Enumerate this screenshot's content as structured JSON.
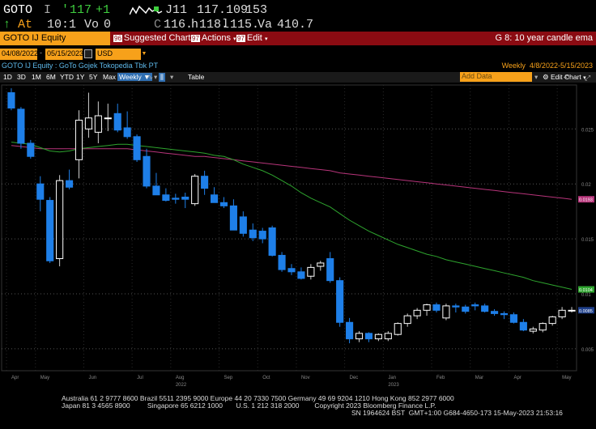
{
  "quote": {
    "ticker": "GOTO",
    "indicator": "I",
    "last_prefix": "'",
    "last": "117",
    "change": "+1",
    "at_label": "At",
    "time": "10:1",
    "vol_label": "Vo",
    "volume": "0",
    "open_prefix": "J11",
    "open": "117.109",
    "open_suffix": "153",
    "bid_prefix": "C",
    "bid": "116.",
    "bid_flag": "h",
    "ask": "118.",
    "ask_flag": "l",
    "high": "115.",
    "val_label": "Va",
    "value": "410.7"
  },
  "function_bar": {
    "security": "GOTO IJ Equity",
    "menus": [
      {
        "num": "96",
        "label": "Suggested Charts"
      },
      {
        "num": "97",
        "label": "Actions"
      },
      {
        "num": "97",
        "label": "Edit"
      }
    ],
    "function_label": "G 8: 10 year candle ema"
  },
  "controls": {
    "start_date": "04/08/2022",
    "end_date": "05/15/2023",
    "currency": "USD",
    "title": "GOTO IJ Equity : GoTo Gojek Tokopedia Tbk PT",
    "period": "Weekly",
    "range": "4/8/2022-5/15/2023",
    "periods": [
      "1D",
      "3D",
      "1M",
      "6M",
      "YTD",
      "1Y",
      "5Y",
      "Max"
    ],
    "frequency": "Weekly",
    "table_label": "Table",
    "add_data_placeholder": "Add Data",
    "edit_chart": "Edit Chart"
  },
  "chart_data": {
    "type": "candlestick",
    "ylim": [
      0.003,
      0.029
    ],
    "y_ticks": [
      0.005,
      0.01,
      0.015,
      0.02,
      0.025
    ],
    "y_tick_labels": [
      "0.005",
      "0.01",
      "0.015",
      "0.02",
      "0.025"
    ],
    "x_tick_labels": [
      "Apr",
      "May",
      "Jun",
      "Jul",
      "Aug",
      "Sep",
      "Oct",
      "Nov",
      "Dec",
      "Jan",
      "Feb",
      "Mar",
      "Apr",
      "May"
    ],
    "year_labels": [
      "2022",
      "2023"
    ],
    "candles": [
      [
        0.0283,
        0.0287,
        0.0267,
        0.0269
      ],
      [
        0.0268,
        0.027,
        0.0232,
        0.0237
      ],
      [
        0.0237,
        0.024,
        0.0223,
        0.0225
      ],
      [
        0.02,
        0.0207,
        0.0175,
        0.0186
      ],
      [
        0.0185,
        0.0188,
        0.0128,
        0.013
      ],
      [
        0.0132,
        0.0208,
        0.0125,
        0.0203
      ],
      [
        0.0203,
        0.0213,
        0.0195,
        0.0197
      ],
      [
        0.0222,
        0.0267,
        0.0205,
        0.0258
      ],
      [
        0.025,
        0.0283,
        0.0242,
        0.026
      ],
      [
        0.0247,
        0.0275,
        0.0237,
        0.0262
      ],
      [
        0.026,
        0.0273,
        0.0248,
        0.026
      ],
      [
        0.0264,
        0.0273,
        0.0247,
        0.0249
      ],
      [
        0.0251,
        0.0266,
        0.0241,
        0.0243
      ],
      [
        0.0243,
        0.0245,
        0.022,
        0.0222
      ],
      [
        0.0225,
        0.0232,
        0.0196,
        0.0198
      ],
      [
        0.0198,
        0.021,
        0.0193,
        0.019
      ],
      [
        0.019,
        0.0196,
        0.0184,
        0.0185
      ],
      [
        0.0187,
        0.0191,
        0.0182,
        0.0186
      ],
      [
        0.0188,
        0.0192,
        0.0178,
        0.0186
      ],
      [
        0.0182,
        0.0209,
        0.018,
        0.0207
      ],
      [
        0.0207,
        0.0212,
        0.019,
        0.0196
      ],
      [
        0.019,
        0.0197,
        0.0183,
        0.0183
      ],
      [
        0.0183,
        0.0188,
        0.0178,
        0.018
      ],
      [
        0.018,
        0.0186,
        0.0163,
        0.0158
      ],
      [
        0.017,
        0.0175,
        0.0152,
        0.0155
      ],
      [
        0.0158,
        0.0164,
        0.0148,
        0.0151
      ],
      [
        0.0157,
        0.016,
        0.0146,
        0.015
      ],
      [
        0.016,
        0.0162,
        0.0134,
        0.0135
      ],
      [
        0.0135,
        0.0138,
        0.012,
        0.0122
      ],
      [
        0.0123,
        0.0127,
        0.0117,
        0.012
      ],
      [
        0.012,
        0.0124,
        0.0113,
        0.0114
      ],
      [
        0.0116,
        0.0127,
        0.0113,
        0.0124
      ],
      [
        0.0125,
        0.013,
        0.0121,
        0.0128
      ],
      [
        0.0132,
        0.0138,
        0.011,
        0.0112
      ],
      [
        0.0112,
        0.0115,
        0.007,
        0.0074
      ],
      [
        0.0074,
        0.0078,
        0.0055,
        0.0059
      ],
      [
        0.0059,
        0.0066,
        0.0056,
        0.0064
      ],
      [
        0.0064,
        0.0065,
        0.0056,
        0.0059
      ],
      [
        0.0059,
        0.0064,
        0.0057,
        0.0063
      ],
      [
        0.0059,
        0.0066,
        0.0057,
        0.0064
      ],
      [
        0.0063,
        0.0074,
        0.0062,
        0.0073
      ],
      [
        0.0073,
        0.0082,
        0.007,
        0.008
      ],
      [
        0.008,
        0.0087,
        0.0077,
        0.0085
      ],
      [
        0.0085,
        0.0091,
        0.008,
        0.009
      ],
      [
        0.009,
        0.0092,
        0.0083,
        0.0085
      ],
      [
        0.0078,
        0.0091,
        0.0076,
        0.0089
      ],
      [
        0.0089,
        0.0091,
        0.0083,
        0.0088
      ],
      [
        0.0088,
        0.009,
        0.0082,
        0.0084
      ],
      [
        0.009,
        0.0092,
        0.0085,
        0.0089
      ],
      [
        0.0089,
        0.0091,
        0.0083,
        0.0084
      ],
      [
        0.0084,
        0.0086,
        0.008,
        0.0082
      ],
      [
        0.0082,
        0.0084,
        0.0077,
        0.0081
      ],
      [
        0.0081,
        0.0083,
        0.0073,
        0.0074
      ],
      [
        0.0074,
        0.0077,
        0.0066,
        0.0067
      ],
      [
        0.0066,
        0.007,
        0.0064,
        0.0068
      ],
      [
        0.0067,
        0.0074,
        0.0065,
        0.0073
      ],
      [
        0.0073,
        0.008,
        0.0071,
        0.0079
      ],
      [
        0.0079,
        0.0088,
        0.0077,
        0.0085
      ],
      [
        0.0085,
        0.0088,
        0.0083,
        0.0085
      ]
    ],
    "ema_long": {
      "color": "#b7347a",
      "values": [
        0.0235,
        0.0234,
        0.0233,
        0.0232,
        0.0232,
        0.0232,
        0.0232,
        0.0232,
        0.0232,
        0.0232,
        0.0232,
        0.0232,
        0.0232,
        0.0231,
        0.023,
        0.0229,
        0.0228,
        0.0227,
        0.0226,
        0.0225,
        0.0225,
        0.0224,
        0.0223,
        0.0222,
        0.0221,
        0.022,
        0.0219,
        0.0218,
        0.0217,
        0.0216,
        0.0215,
        0.0214,
        0.0213,
        0.0212,
        0.021,
        0.0209,
        0.0208,
        0.0207,
        0.0206,
        0.0205,
        0.0204,
        0.0203,
        0.0202,
        0.0201,
        0.02,
        0.0199,
        0.0198,
        0.0197,
        0.0196,
        0.0195,
        0.0194,
        0.0193,
        0.0192,
        0.0191,
        0.019,
        0.0189,
        0.0188,
        0.0187,
        0.0186
      ],
      "end_label": "0.0193"
    },
    "ema_short": {
      "color": "#2ea42e",
      "values": [
        0.0238,
        0.0237,
        0.0236,
        0.0233,
        0.023,
        0.0229,
        0.023,
        0.0232,
        0.0233,
        0.0234,
        0.0235,
        0.0236,
        0.0236,
        0.0235,
        0.0234,
        0.0233,
        0.0232,
        0.0231,
        0.023,
        0.0229,
        0.0228,
        0.0226,
        0.0225,
        0.0222,
        0.0218,
        0.0215,
        0.0212,
        0.0208,
        0.0203,
        0.0198,
        0.0192,
        0.0187,
        0.0183,
        0.0179,
        0.0173,
        0.0167,
        0.0162,
        0.0157,
        0.0153,
        0.0149,
        0.0145,
        0.0142,
        0.0139,
        0.0136,
        0.0134,
        0.0131,
        0.0129,
        0.0127,
        0.0125,
        0.0123,
        0.0121,
        0.0119,
        0.0117,
        0.0115,
        0.0112,
        0.011,
        0.0108,
        0.0106,
        0.0104
      ],
      "end_label": "0.0104"
    },
    "last_label": "0.0085",
    "colors": {
      "up": "#ffffff",
      "down": "#1e7fe8",
      "axis": "#888888"
    }
  },
  "footer": {
    "line1": "Australia 61 2 9777 8600 Brazil 5511 2395 9000 Europe 44 20 7330 7500 Germany 49 69 9204 1210 Hong Kong 852 2977 6000",
    "line2": "Japan 81 3 4565 8900         Singapore 65 6212 1000       U.S. 1 212 318 2000        Copyright 2023 Bloomberg Finance L.P.",
    "line3": "SN 1964624 BST  GMT+1:00 G684-4650-173 15-May-2023 21:53:16"
  }
}
